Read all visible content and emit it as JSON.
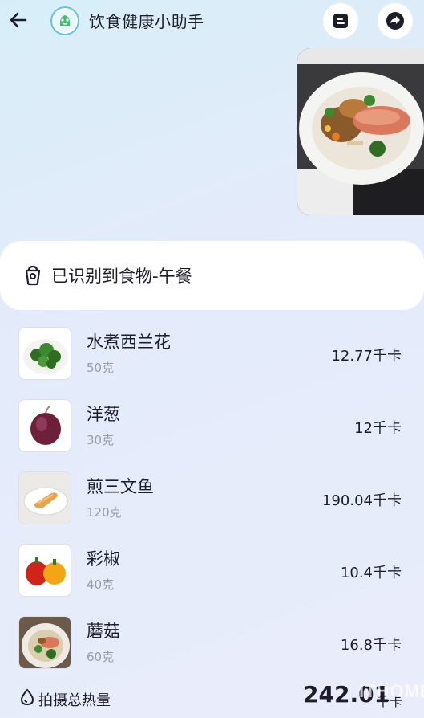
{
  "header": {
    "title": "饮食健康小助手"
  },
  "icons": {
    "back": "arrow-left-icon",
    "doc": "document-icon",
    "share": "share-arrow-icon",
    "recognized": "food-bowl-icon",
    "total": "flame-drop-icon"
  },
  "recognized": {
    "title": "已识别到食物-午餐"
  },
  "foods": [
    {
      "name": "水煮西兰花",
      "weight": "50克",
      "kcal": "12.77千卡"
    },
    {
      "name": "洋葱",
      "weight": "30克",
      "kcal": "12千卡"
    },
    {
      "name": "煎三文鱼",
      "weight": "120克",
      "kcal": "190.04千卡"
    },
    {
      "name": "彩椒",
      "weight": "40克",
      "kcal": "10.4千卡"
    },
    {
      "name": "蘑菇",
      "weight": "60克",
      "kcal": "16.8千卡"
    }
  ],
  "total": {
    "label": "拍摄总热量",
    "value": "242.01",
    "unit": "千卡"
  },
  "watermark": "ITHOME",
  "colors": {
    "accent": "#5cc4ef",
    "text": "#1d1d29",
    "muted": "#9a9ca8"
  }
}
